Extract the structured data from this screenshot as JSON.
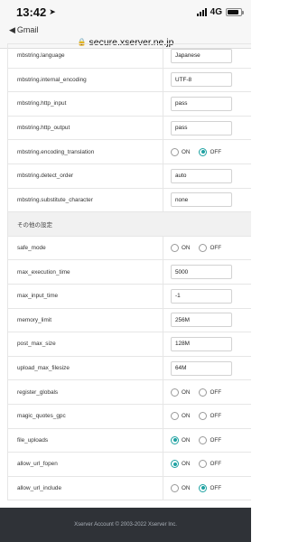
{
  "status_bar": {
    "time": "13:42",
    "network": "4G",
    "battery_level": 0.85
  },
  "nav": {
    "back_label": "Gmail",
    "url": "secure.xserver.ne.jp"
  },
  "rows_top": [
    {
      "label": "mbstring.language",
      "value": "Japanese"
    },
    {
      "label": "mbstring.internal_encoding",
      "value": "UTF-8"
    },
    {
      "label": "mbstring.http_input",
      "value": "pass"
    },
    {
      "label": "mbstring.http_output",
      "value": "pass"
    },
    {
      "label": "mbstring.encoding_translation",
      "on_label": "ON",
      "off_label": "OFF",
      "selected": "OFF"
    },
    {
      "label": "mbstring.detect_order",
      "value": "auto"
    },
    {
      "label": "mbstring.substitute_character",
      "value": "none"
    }
  ],
  "section_title": "その他の設定",
  "rows_bottom": [
    {
      "label": "safe_mode",
      "on_label": "ON",
      "off_label": "OFF",
      "selected": ""
    },
    {
      "label": "max_execution_time",
      "value": "5000"
    },
    {
      "label": "max_input_time",
      "value": "-1"
    },
    {
      "label": "memory_limit",
      "value": "256M"
    },
    {
      "label": "post_max_size",
      "value": "128M"
    },
    {
      "label": "upload_max_filesize",
      "value": "64M"
    },
    {
      "label": "register_globals",
      "on_label": "ON",
      "off_label": "OFF",
      "selected": ""
    },
    {
      "label": "magic_quotes_gpc",
      "on_label": "ON",
      "off_label": "OFF",
      "selected": ""
    },
    {
      "label": "file_uploads",
      "on_label": "ON",
      "off_label": "OFF",
      "selected": "ON"
    },
    {
      "label": "allow_url_fopen",
      "on_label": "ON",
      "off_label": "OFF",
      "selected": "ON"
    },
    {
      "label": "allow_url_include",
      "on_label": "ON",
      "off_label": "OFF",
      "selected": "OFF"
    }
  ],
  "footer": {
    "copyright": "Xserver Account © 2003-2022 Xserver Inc."
  },
  "colors": {
    "accent": "#1fa2a2",
    "footer_bg": "#2f3237"
  }
}
